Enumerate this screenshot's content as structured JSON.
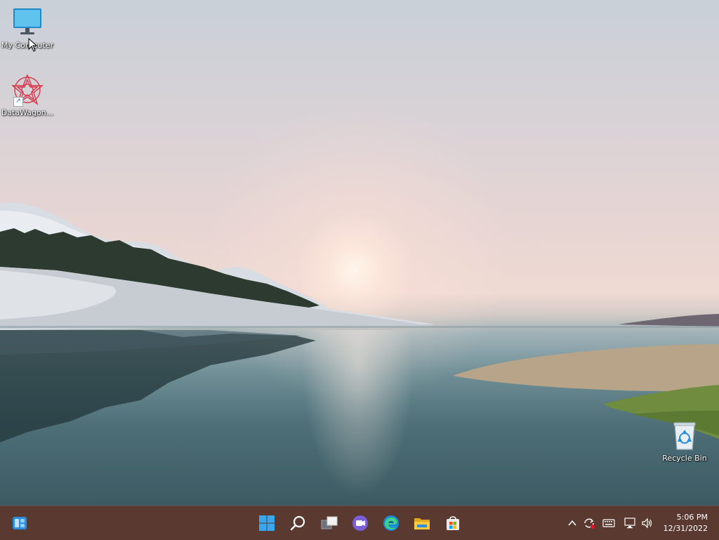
{
  "desktop": {
    "icons": [
      {
        "label": "My Computer",
        "icon": "monitor-icon"
      },
      {
        "label": "DataWagon...",
        "icon": "datawagon-icon"
      },
      {
        "label": "Recycle Bin",
        "icon": "recycle-bin-icon"
      }
    ]
  },
  "taskbar": {
    "left": {
      "icon": "widgets-icon"
    },
    "pinned": [
      {
        "name": "Start",
        "icon": "windows-start-icon"
      },
      {
        "name": "Search",
        "icon": "search-icon"
      },
      {
        "name": "Task View",
        "icon": "task-view-icon"
      },
      {
        "name": "Chat",
        "icon": "teams-chat-icon"
      },
      {
        "name": "Microsoft Edge",
        "icon": "edge-icon"
      },
      {
        "name": "File Explorer",
        "icon": "folder-icon"
      },
      {
        "name": "Microsoft Store",
        "icon": "store-icon"
      }
    ],
    "tray": {
      "icons": [
        "chevron-up-icon",
        "sync-icon",
        "keyboard-icon",
        "network-icon",
        "volume-icon"
      ],
      "time": "5:06 PM",
      "date": "12/31/2022"
    }
  },
  "colors": {
    "taskbar": "#5a3a30",
    "accent": "#2a8fe0"
  }
}
